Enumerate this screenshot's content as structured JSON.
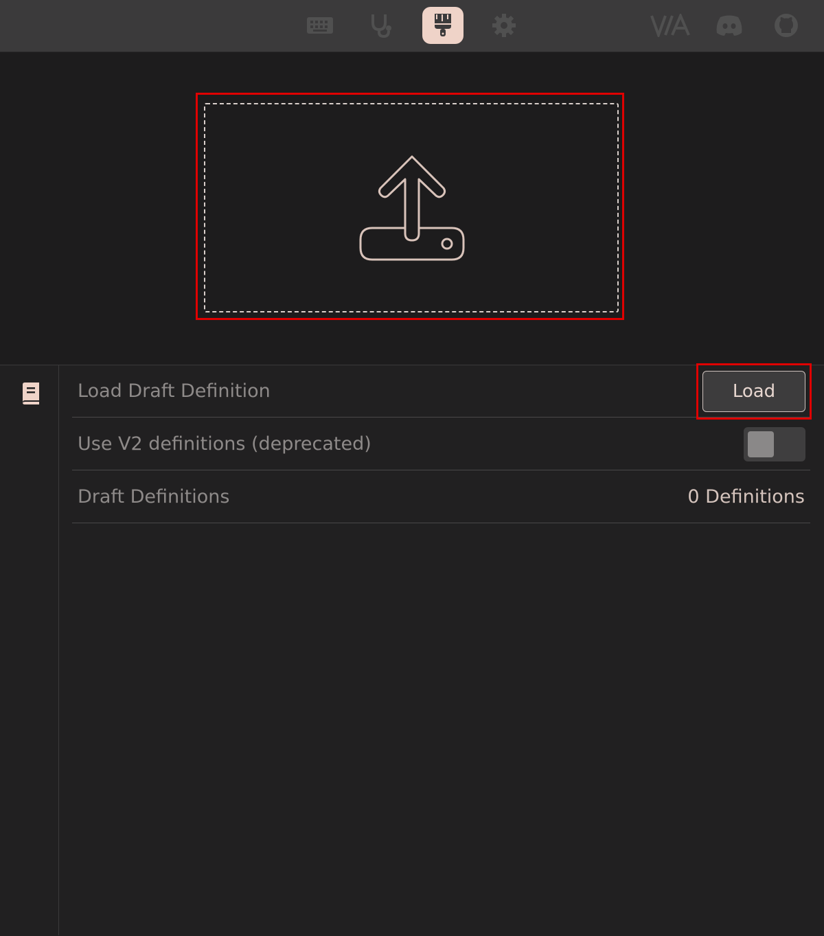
{
  "topbar": {
    "nav_icons": [
      {
        "name": "keyboard-icon",
        "active": false
      },
      {
        "name": "stethoscope-icon",
        "active": false
      },
      {
        "name": "paintbrush-icon",
        "active": true
      },
      {
        "name": "gear-icon",
        "active": false
      }
    ],
    "brand_logo": "VIA",
    "external_icons": [
      "discord-icon",
      "github-icon"
    ]
  },
  "upload": {
    "icon": "upload-icon"
  },
  "sidebar": {
    "icon": "book-icon"
  },
  "settings": {
    "rows": [
      {
        "label": "Load Draft Definition",
        "control": "button",
        "button_label": "Load"
      },
      {
        "label": "Use V2 definitions (deprecated)",
        "control": "toggle",
        "toggle_on": false
      },
      {
        "label": "Draft Definitions",
        "control": "value",
        "value": "0 Definitions"
      }
    ]
  },
  "colors": {
    "accent": "#efd3c8",
    "highlight": "#e00000",
    "topbar_bg": "#3b3a3b",
    "panel_bg": "#212021"
  }
}
